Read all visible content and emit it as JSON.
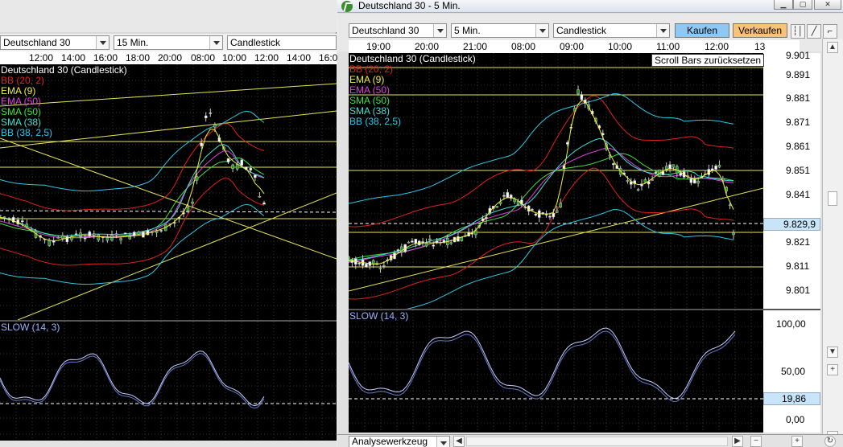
{
  "left_window": {
    "symbol": "Deutschland 30",
    "interval": "15 Min.",
    "chart_type": "Candlestick",
    "time_labels": [
      "12:00",
      "14:00",
      "16:00",
      "18:00",
      "20:00",
      "08:00",
      "10:00",
      "12:00",
      "14:00",
      "16:0"
    ],
    "chart_title": "Deutschland 30 (Candlestick)",
    "indicators": [
      {
        "label": "BB (20, 2)",
        "color": "#e02020"
      },
      {
        "label": "EMA (9)",
        "color": "#f0f040"
      },
      {
        "label": "EMA (50)",
        "color": "#e040e0"
      },
      {
        "label": "SMA (50)",
        "color": "#40e040"
      },
      {
        "label": "SMA (38)",
        "color": "#40e0d0"
      },
      {
        "label": "BB (38, 2,5)",
        "color": "#30c8e8"
      }
    ],
    "oscillator_label": "SLOW (14, 3)"
  },
  "right_window": {
    "title": "Deutschland 30 - 5 Min.",
    "symbol": "Deutschland 30",
    "interval": "5 Min.",
    "chart_type": "Candlestick",
    "buy_label": "Kaufen",
    "sell_label": "Verkaufen",
    "time_labels": [
      "19:00",
      "20:00",
      "21:00",
      "08:00",
      "09:00",
      "10:00",
      "11:00",
      "12:00",
      "13"
    ],
    "tooltip": "Scroll Bars zurücksetzen",
    "chart_title": "Deutschland 30 (Candlestick)",
    "indicators": [
      {
        "label": "BB (20, 2)",
        "color": "#e02020"
      },
      {
        "label": "EMA (9)",
        "color": "#f0f040"
      },
      {
        "label": "EMA (50)",
        "color": "#e040e0"
      },
      {
        "label": "SMA (50)",
        "color": "#40e040"
      },
      {
        "label": "SMA (38)",
        "color": "#40e0d0"
      },
      {
        "label": "BB (38, 2,5)",
        "color": "#30c8e8"
      }
    ],
    "price_labels": [
      "9.901",
      "9.891",
      "9.881",
      "9.871",
      "9.861",
      "9.851",
      "9.841",
      "9.821",
      "9.811",
      "9.801"
    ],
    "current_price": "9.829,9",
    "oscillator_label": "SLOW (14, 3)",
    "oscillator_labels": [
      "100,00",
      "50,00",
      "0,00"
    ],
    "oscillator_current": "19,86",
    "analysis_tool": "Analysewerkzeug",
    "colors": {
      "buy": "#8ec9f5",
      "sell": "#f7c27a",
      "current_price_bg": "#c8e4f8"
    }
  }
}
